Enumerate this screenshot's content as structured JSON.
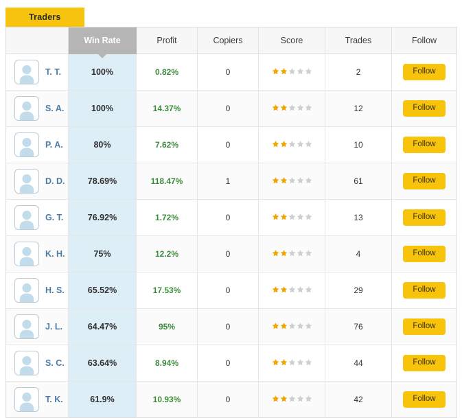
{
  "tabs": [
    {
      "label": "Traders",
      "active": true
    }
  ],
  "table": {
    "columns": [
      {
        "key": "trader",
        "label": "",
        "sorted": false
      },
      {
        "key": "win",
        "label": "Win Rate",
        "sorted": true,
        "sort_direction": "desc"
      },
      {
        "key": "profit",
        "label": "Profit",
        "sorted": false
      },
      {
        "key": "copiers",
        "label": "Copiers",
        "sorted": false
      },
      {
        "key": "score",
        "label": "Score",
        "sorted": false
      },
      {
        "key": "trades",
        "label": "Trades",
        "sorted": false
      },
      {
        "key": "follow",
        "label": "Follow",
        "sorted": false
      }
    ],
    "follow_label": "Follow",
    "avatar_icon": "user-avatar-icon",
    "star_max": 5,
    "rows": [
      {
        "name": "T. T.",
        "win_rate": "100%",
        "profit": "0.82%",
        "copiers": "0",
        "score": 2,
        "trades": "2"
      },
      {
        "name": "S. A.",
        "win_rate": "100%",
        "profit": "14.37%",
        "copiers": "0",
        "score": 2,
        "trades": "12"
      },
      {
        "name": "P. A.",
        "win_rate": "80%",
        "profit": "7.62%",
        "copiers": "0",
        "score": 2,
        "trades": "10"
      },
      {
        "name": "D. D.",
        "win_rate": "78.69%",
        "profit": "118.47%",
        "copiers": "1",
        "score": 2,
        "trades": "61"
      },
      {
        "name": "G. T.",
        "win_rate": "76.92%",
        "profit": "1.72%",
        "copiers": "0",
        "score": 2,
        "trades": "13"
      },
      {
        "name": "K. H.",
        "win_rate": "75%",
        "profit": "12.2%",
        "copiers": "0",
        "score": 2,
        "trades": "4"
      },
      {
        "name": "H. S.",
        "win_rate": "65.52%",
        "profit": "17.53%",
        "copiers": "0",
        "score": 2,
        "trades": "29"
      },
      {
        "name": "J. L.",
        "win_rate": "64.47%",
        "profit": "95%",
        "copiers": "0",
        "score": 2,
        "trades": "76"
      },
      {
        "name": "S. C.",
        "win_rate": "63.64%",
        "profit": "8.94%",
        "copiers": "0",
        "score": 2,
        "trades": "44"
      },
      {
        "name": "T. K.",
        "win_rate": "61.9%",
        "profit": "10.93%",
        "copiers": "0",
        "score": 2,
        "trades": "42"
      }
    ]
  },
  "colors": {
    "tab_active": "#f6c40e",
    "follow_button": "#f7c40b",
    "sorted_header": "#b5b5b5",
    "sorted_column": "#deeef7",
    "profit_text": "#3c8c3c",
    "trader_name": "#4b7ca8",
    "star_filled": "#f0a500",
    "star_empty": "#cfcfcf"
  }
}
